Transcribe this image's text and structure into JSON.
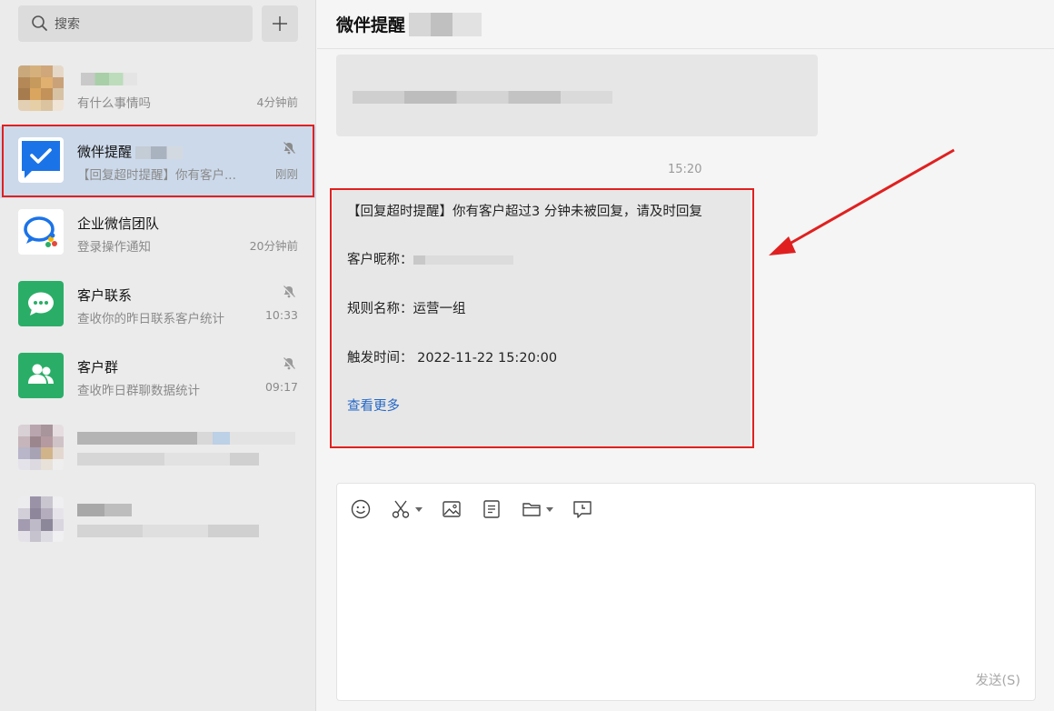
{
  "search": {
    "placeholder": "搜索"
  },
  "conversations": [
    {
      "name": "",
      "preview": "有什么事情吗",
      "time": "4分钟前"
    },
    {
      "name": "微伴提醒",
      "preview": "【回复超时提醒】你有客户...",
      "time": "刚刚",
      "muted": true,
      "selected": true
    },
    {
      "name": "企业微信团队",
      "preview": "登录操作通知",
      "time": "20分钟前"
    },
    {
      "name": "客户联系",
      "preview": "查收你的昨日联系客户统计",
      "time": "10:33",
      "muted": true
    },
    {
      "name": "客户群",
      "preview": "查收昨日群聊数据统计",
      "time": "09:17",
      "muted": true
    }
  ],
  "chat": {
    "title": "微伴提醒",
    "timestamp": "15:20",
    "message": {
      "line1": "【回复超时提醒】你有客户超过3 分钟未被回复，请及时回复",
      "nickname_label": "客户昵称：",
      "rule_label": "规则名称：运营一组",
      "trigger_label": "触发时间：  2022-11-22 15:20:00",
      "more_link": "查看更多"
    }
  },
  "composer": {
    "send_label": "发送(S)",
    "tools": [
      "emoji-icon",
      "scissors-icon",
      "image-icon",
      "document-icon",
      "folder-icon",
      "chat-history-icon"
    ]
  },
  "colors": {
    "selected_row": "#ccd9ea",
    "highlight_red": "#e02020",
    "link_blue": "#2467c6",
    "green_app": "#2aae67",
    "blue_app": "#1b73e8"
  }
}
